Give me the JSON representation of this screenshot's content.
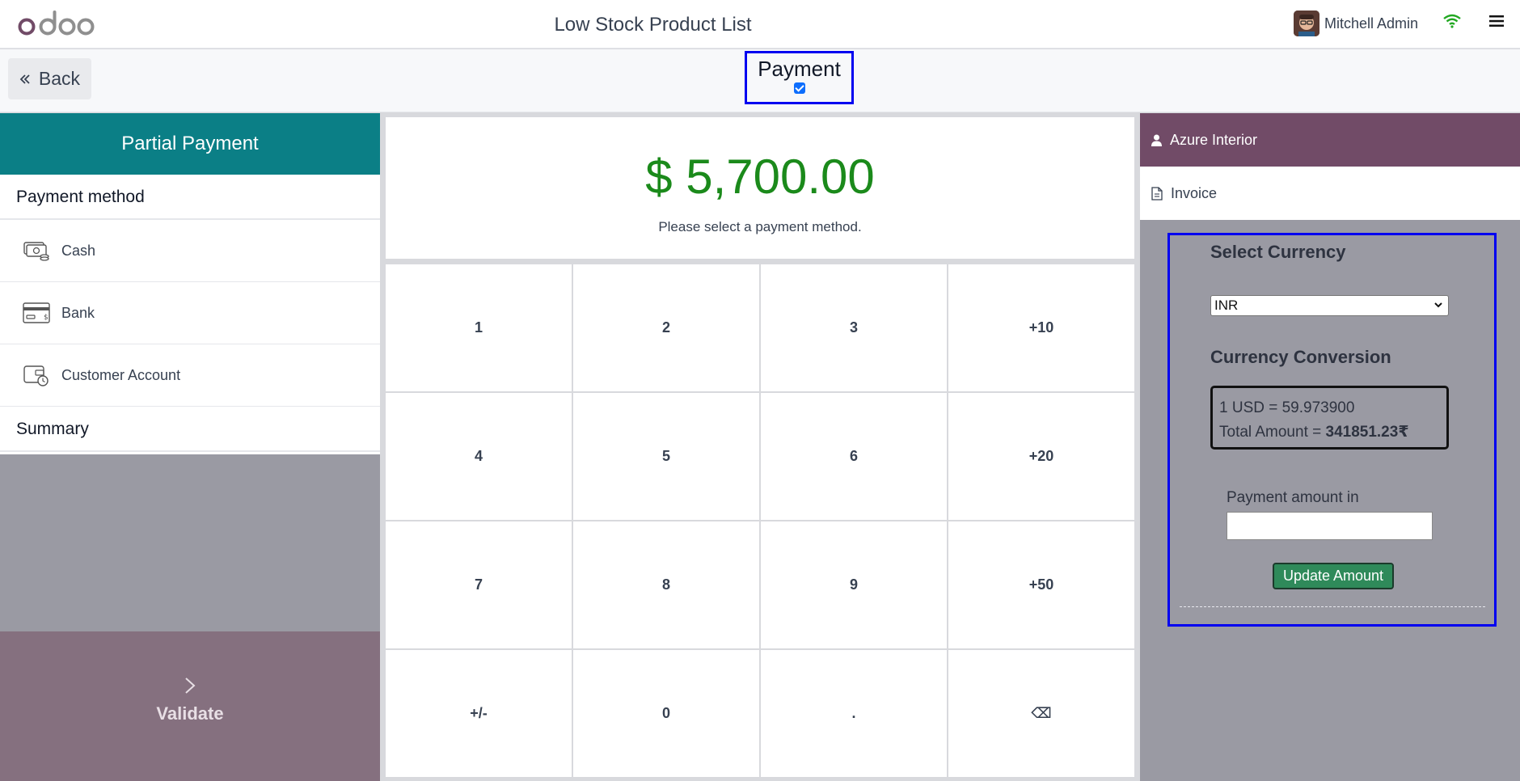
{
  "navbar": {
    "logo_text": "odoo",
    "title": "Low Stock Product List",
    "user_name": "Mitchell Admin"
  },
  "controlbar": {
    "back_label": "Back",
    "payment_label": "Payment",
    "payment_checked": true
  },
  "left": {
    "header": "Partial Payment",
    "methods_title": "Payment method",
    "methods": [
      {
        "label": "Cash",
        "icon": "cash-icon"
      },
      {
        "label": "Bank",
        "icon": "bank-card-icon"
      },
      {
        "label": "Customer Account",
        "icon": "customer-account-icon"
      }
    ],
    "summary_title": "Summary",
    "validate_label": "Validate"
  },
  "center": {
    "amount": "$ 5,700.00",
    "hint": "Please select a payment method.",
    "keys": [
      "1",
      "2",
      "3",
      "+10",
      "4",
      "5",
      "6",
      "+20",
      "7",
      "8",
      "9",
      "+50",
      "+/-",
      "0",
      ".",
      "⌫"
    ]
  },
  "right": {
    "customer": "Azure Interior",
    "invoice": "Invoice",
    "select_currency_title": "Select Currency",
    "selected_currency": "INR",
    "conversion_title": "Currency Conversion",
    "rate_text": "1 USD = 59.973900",
    "total_prefix": "Total Amount = ",
    "total_value": "341851.23₹",
    "payment_in_label": "Payment amount in",
    "payment_in_value": "",
    "update_label": "Update Amount"
  },
  "colors": {
    "brand_purple": "#714b67",
    "teal": "#0b7f86",
    "amount_green": "#1b8a1b",
    "highlight_blue": "#0000f0"
  }
}
